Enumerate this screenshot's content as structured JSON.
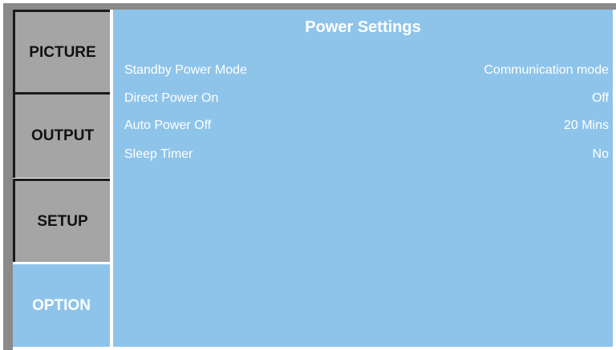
{
  "sidebar": {
    "tabs": [
      {
        "label": "PICTURE",
        "active": false
      },
      {
        "label": "OUTPUT",
        "active": false
      },
      {
        "label": "SETUP",
        "active": false
      },
      {
        "label": "OPTION",
        "active": true
      }
    ]
  },
  "panel": {
    "title": "Power Settings",
    "rows": [
      {
        "label": "Standby Power Mode",
        "value": "Communication mode"
      },
      {
        "label": "Direct Power On",
        "value": "Off"
      },
      {
        "label": "Auto Power Off",
        "value": "20 Mins"
      },
      {
        "label": "Sleep Timer",
        "value": "No"
      }
    ]
  },
  "colors": {
    "active_background": "#8ec4ea",
    "inactive_tab": "#a5a5a5",
    "frame": "#8a8a8a",
    "text_light": "#ffffff",
    "text_dark": "#111111"
  }
}
